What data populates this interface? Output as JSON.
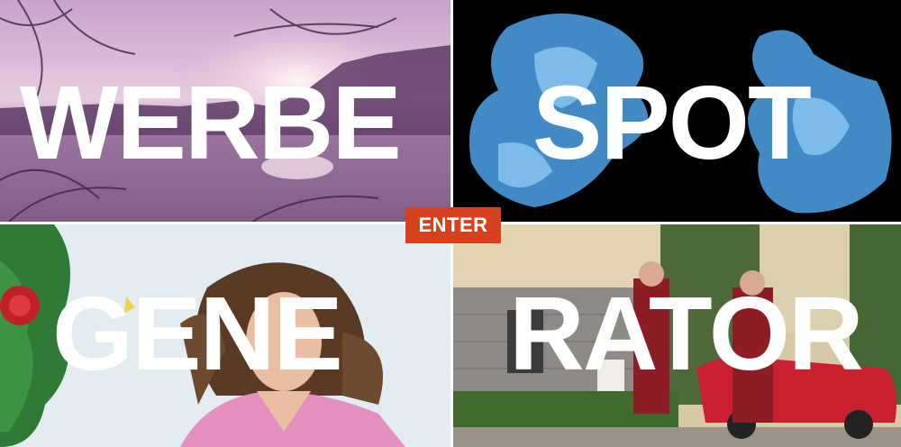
{
  "title_words": {
    "top_left": "WERBE",
    "top_right": "SPOT",
    "bottom_left": "GENE",
    "bottom_right": "RATOR"
  },
  "enter_button": {
    "label": "ENTER",
    "color": "#d5421d"
  },
  "panels": [
    {
      "subject": "misty lake at sunset with bare branches",
      "tone": "#b58fb6"
    },
    {
      "subject": "blue ink smoke on black",
      "tone": "#4a9be0"
    },
    {
      "subject": "woman with flowing hair, pink top, green cloth and red rose",
      "tone": "#dfe9f0"
    },
    {
      "subject": "people in tartan outfits by a red car in front of a stone building",
      "tone": "#c8b89a"
    }
  ]
}
